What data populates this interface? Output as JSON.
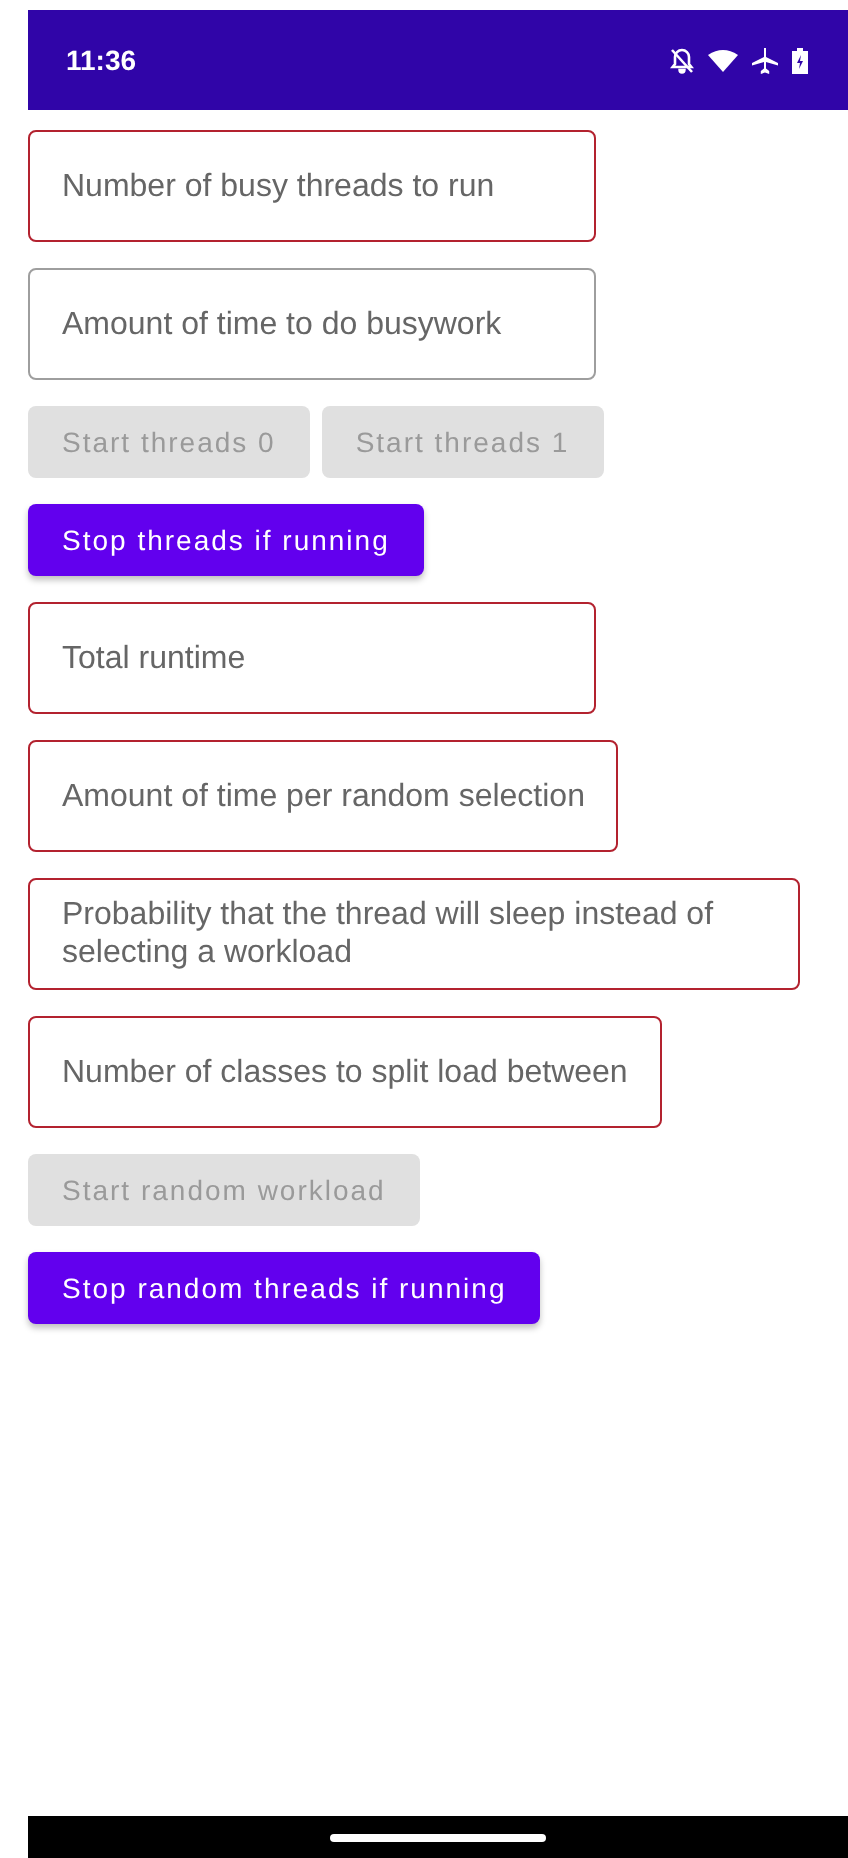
{
  "status_bar": {
    "time": "11:36"
  },
  "items": [
    {
      "kind": "field",
      "placeholder": "Number of busy threads to run",
      "error": true
    },
    {
      "kind": "field",
      "placeholder": "Amount of time to do busywork",
      "error": false
    },
    {
      "kind": "buttons",
      "buttons": [
        {
          "label": "Start threads 0",
          "disabled": true
        },
        {
          "label": "Start threads 1",
          "disabled": true
        }
      ]
    },
    {
      "kind": "buttons",
      "buttons": [
        {
          "label": "Stop threads if running",
          "disabled": false
        }
      ]
    },
    {
      "kind": "field",
      "placeholder": "Total runtime",
      "error": true
    },
    {
      "kind": "field",
      "placeholder": "Amount of time per random selection",
      "error": true
    },
    {
      "kind": "field",
      "placeholder": "Probability that the thread will sleep instead of selecting a workload",
      "error": true
    },
    {
      "kind": "field",
      "placeholder": "Number of classes to split load between",
      "error": true
    },
    {
      "kind": "buttons",
      "buttons": [
        {
          "label": "Start random workload",
          "disabled": true
        }
      ]
    },
    {
      "kind": "buttons",
      "buttons": [
        {
          "label": "Stop random threads if running",
          "disabled": false
        }
      ]
    }
  ]
}
